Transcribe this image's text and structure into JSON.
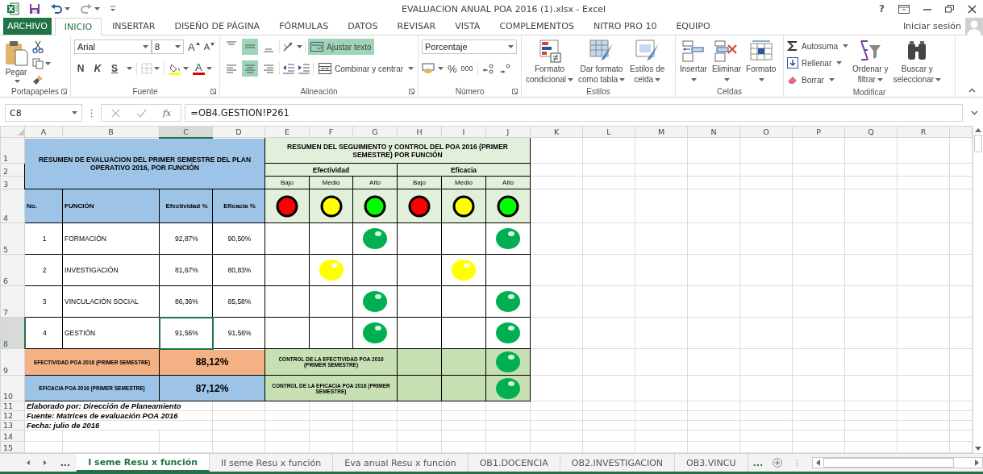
{
  "window": {
    "title": "EVALUACION ANUAL POA 2016 (1).xlsx - Excel",
    "help": "?"
  },
  "ribbon_tabs": [
    {
      "label": "ARCHIVO",
      "kind": "file",
      "selected": false
    },
    {
      "label": "INICIO",
      "kind": "tab",
      "selected": true
    },
    {
      "label": "INSERTAR",
      "kind": "tab",
      "selected": false
    },
    {
      "label": "DISEÑO DE PÁGINA",
      "kind": "tab",
      "selected": false
    },
    {
      "label": "FÓRMULAS",
      "kind": "tab",
      "selected": false
    },
    {
      "label": "DATOS",
      "kind": "tab",
      "selected": false
    },
    {
      "label": "REVISAR",
      "kind": "tab",
      "selected": false
    },
    {
      "label": "VISTA",
      "kind": "tab",
      "selected": false
    },
    {
      "label": "COMPLEMENTOS",
      "kind": "tab",
      "selected": false
    },
    {
      "label": "NITRO PRO 10",
      "kind": "tab",
      "selected": false
    },
    {
      "label": "EQUIPO",
      "kind": "tab",
      "selected": false
    }
  ],
  "account": {
    "label": "Iniciar sesión"
  },
  "ribbon_groups": [
    {
      "kind": "clipboard",
      "title": "Portapapeles",
      "paste": "Pegar"
    },
    {
      "kind": "font",
      "title": "Fuente",
      "family": "Arial",
      "size": "8",
      "grow": "A",
      "shrink": "A",
      "styles": [
        {
          "label": "N"
        },
        {
          "label": "K"
        },
        {
          "label": "S"
        }
      ],
      "color_letter": "A"
    },
    {
      "kind": "alignment",
      "title": "Alineación",
      "vertical_align": [
        {
          "selected": false
        },
        {
          "selected": true
        },
        {
          "selected": false
        }
      ],
      "horizontal_align": [
        {
          "selected": false
        },
        {
          "selected": true
        },
        {
          "selected": false
        }
      ],
      "wrap": {
        "label": "Ajustar texto",
        "on": true
      },
      "merge": "Combinar y centrar"
    },
    {
      "kind": "number",
      "title": "Número",
      "format": "Porcentaje",
      "percent": "%",
      "thousands": "000"
    },
    {
      "kind": "styles",
      "title": "Estilos",
      "buttons": [
        {
          "kind": "conditional",
          "lines": [
            "Formato",
            "condicional"
          ]
        },
        {
          "kind": "table",
          "lines": [
            "Dar formato",
            "como tabla"
          ]
        },
        {
          "kind": "cellstyle",
          "lines": [
            "Estilos de",
            "celda"
          ]
        }
      ]
    },
    {
      "kind": "cells",
      "title": "Celdas",
      "buttons": [
        {
          "kind": "insert",
          "label": "Insertar"
        },
        {
          "kind": "delete",
          "label": "Eliminar"
        },
        {
          "kind": "format",
          "label": "Formato"
        }
      ]
    },
    {
      "kind": "editing",
      "title": "Modificar",
      "items": [
        {
          "kind": "sum",
          "label": "Autosuma"
        },
        {
          "kind": "fill",
          "label": "Rellenar"
        },
        {
          "kind": "clear",
          "label": "Borrar"
        }
      ],
      "buttons": [
        {
          "kind": "sort",
          "lines": [
            "Ordenar y",
            "filtrar"
          ]
        },
        {
          "kind": "find",
          "lines": [
            "Buscar y",
            "seleccionar"
          ]
        }
      ]
    }
  ],
  "formula_bar": {
    "name_box": "C8",
    "function_label": "fx",
    "formula": "=OB4.GESTION!P261"
  },
  "columns": [
    {
      "label": "A",
      "selected": false
    },
    {
      "label": "B",
      "selected": false
    },
    {
      "label": "C",
      "selected": true
    },
    {
      "label": "D",
      "selected": false
    },
    {
      "label": "E",
      "selected": false
    },
    {
      "label": "F",
      "selected": false
    },
    {
      "label": "G",
      "selected": false
    },
    {
      "label": "H",
      "selected": false
    },
    {
      "label": "I",
      "selected": false
    },
    {
      "label": "J",
      "selected": false
    },
    {
      "label": "K",
      "selected": false
    },
    {
      "label": "L",
      "selected": false
    },
    {
      "label": "M",
      "selected": false
    },
    {
      "label": "N",
      "selected": false
    },
    {
      "label": "O",
      "selected": false
    },
    {
      "label": "P",
      "selected": false
    },
    {
      "label": "Q",
      "selected": false
    },
    {
      "label": "R",
      "selected": false
    }
  ],
  "row_headers": [
    {
      "label": "1",
      "selected": false
    },
    {
      "label": "2",
      "selected": false
    },
    {
      "label": "3",
      "selected": false
    },
    {
      "label": "4",
      "selected": false
    },
    {
      "label": "5",
      "selected": false
    },
    {
      "label": "6",
      "selected": false
    },
    {
      "label": "7",
      "selected": false
    },
    {
      "label": "8",
      "selected": true
    },
    {
      "label": "9",
      "selected": false
    },
    {
      "label": "10",
      "selected": false
    },
    {
      "label": "11",
      "selected": false
    },
    {
      "label": "12",
      "selected": false
    },
    {
      "label": "13",
      "selected": false
    },
    {
      "label": "14",
      "selected": false
    },
    {
      "label": "15",
      "selected": false
    }
  ],
  "sheet": {
    "left_title": "RESUMEN DE EVALUACION DEL PRIMER SEMESTRE DEL PLAN OPERATIVO 2016, POR FUNCIÓN",
    "right_title": "RESUMEN DEL SEGUIMIENTO y CONTROL DEL POA 2016 (PRIMER SEMESTRE) POR FUNCIÓN",
    "groups": [
      {
        "label": "Efectividad",
        "levels": [
          {
            "label": "Bajo",
            "color": "#ff0000"
          },
          {
            "label": "Medio",
            "color": "#ffff00"
          },
          {
            "label": "Alto",
            "color": "#00ff00"
          }
        ]
      },
      {
        "label": "Eficacia",
        "levels": [
          {
            "label": "Bajo",
            "color": "#ff0000"
          },
          {
            "label": "Medio",
            "color": "#ffff00"
          },
          {
            "label": "Alto",
            "color": "#00ff00"
          }
        ]
      }
    ],
    "headers": [
      "No.",
      "FUNCIÓN",
      "Efectividad %",
      "Eficacia %"
    ],
    "rows": [
      {
        "no": "1",
        "function": "FORMACIÓN",
        "effectiveness": "92,87%",
        "efficacy": "90,50%",
        "effectiveness_lights": [
          false,
          false,
          true
        ],
        "efficacy_lights": [
          false,
          false,
          true
        ],
        "selected": false
      },
      {
        "no": "2",
        "function": "INVESTIGACIÓN",
        "effectiveness": "81,67%",
        "efficacy": "80,83%",
        "effectiveness_lights": [
          false,
          true,
          false
        ],
        "efficacy_lights": [
          false,
          true,
          false
        ],
        "selected": false
      },
      {
        "no": "3",
        "function": "VINCULACIÓN SOCIAL",
        "effectiveness": "86,36%",
        "efficacy": "85,58%",
        "effectiveness_lights": [
          false,
          false,
          true
        ],
        "efficacy_lights": [
          false,
          false,
          true
        ],
        "selected": false
      },
      {
        "no": "4",
        "function": "GESTIÓN",
        "effectiveness": "91,56%",
        "efficacy": "91,56%",
        "effectiveness_lights": [
          false,
          false,
          true
        ],
        "efficacy_lights": [
          false,
          false,
          true
        ],
        "selected": true
      }
    ],
    "summary": [
      {
        "label": "EFECTIVIDAD POA 2016 (PRIMER SEMESTRE)",
        "value": "88,12%",
        "color": "#f4b183",
        "control_label": "CONTROL DE LA EFECTIVIDAD POA 2016 (PRIMER SEMESTRE)",
        "control_lights": [
          false,
          false,
          true
        ]
      },
      {
        "label": "EFICACIA POA 2016 (PRIMER SEMESTRE)",
        "value": "87,12%",
        "color": "#9dc3e6",
        "control_label": "CONTROL DE LA EFICACIA POA 2016 (PRIMER SEMESTRE)",
        "control_lights": [
          false,
          false,
          true
        ]
      }
    ],
    "notes": [
      "Elaborado por: Dirección de Planeamiento",
      "Fuente: Matrices de evaluación POA 2016",
      "Fecha: julio de 2016"
    ]
  },
  "sheet_tabs": {
    "more_left": "...",
    "more_right": "...",
    "tabs": [
      {
        "label": "I seme Resu x función",
        "selected": true
      },
      {
        "label": "II seme Resu x función",
        "selected": false
      },
      {
        "label": "Eva anual Resu x función",
        "selected": false
      },
      {
        "label": "OB1.DOCENCIA",
        "selected": false
      },
      {
        "label": "OB2.INVESTIGACION",
        "selected": false
      },
      {
        "label": "OB3.VINCU",
        "selected": false
      }
    ]
  }
}
